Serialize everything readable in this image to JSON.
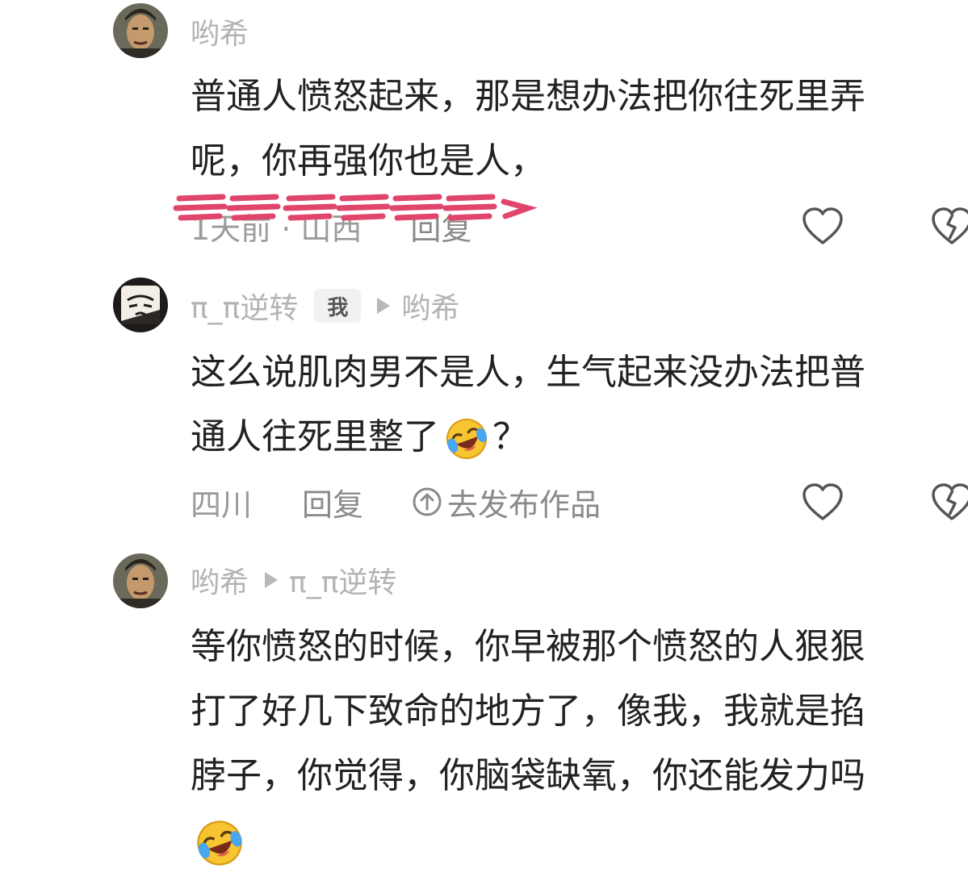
{
  "comments": [
    {
      "author": "哟希",
      "body_lines": [
        "普通人愤怒起来，那是想办法把你往死里弄",
        "呢，你再强你也是人，"
      ],
      "meta": {
        "time_location": "1天前 · 山西",
        "reply": "回复"
      }
    },
    {
      "author": "π_π逆转",
      "me_badge": "我",
      "reply_to": "哟希",
      "body_lines": [
        "这么说肌肉男不是人，生气起来没办法把普",
        "通人往死里整了"
      ],
      "body_suffix": "？",
      "meta": {
        "location": "四川",
        "reply": "回复",
        "publish": "去发布作品"
      }
    },
    {
      "author": "哟希",
      "reply_to": "π_π逆转",
      "body_lines": [
        "等你愤怒的时候，你早被那个愤怒的人狠狠",
        "打了好几下致命的地方了，像我，我就是掐",
        "脖子，你觉得，你脑袋缺氧，你还能发力吗"
      ]
    }
  ],
  "icons": {
    "like": "heart-outline-icon",
    "dislike": "broken-heart-icon",
    "emoji": "rolling-on-floor-laughing-emoji",
    "publish": "upload-circle-icon"
  },
  "colors": {
    "text": "#222222",
    "muted": "#b3b3b3",
    "meta": "#9a9a9a",
    "scribble": "#e0456b"
  }
}
